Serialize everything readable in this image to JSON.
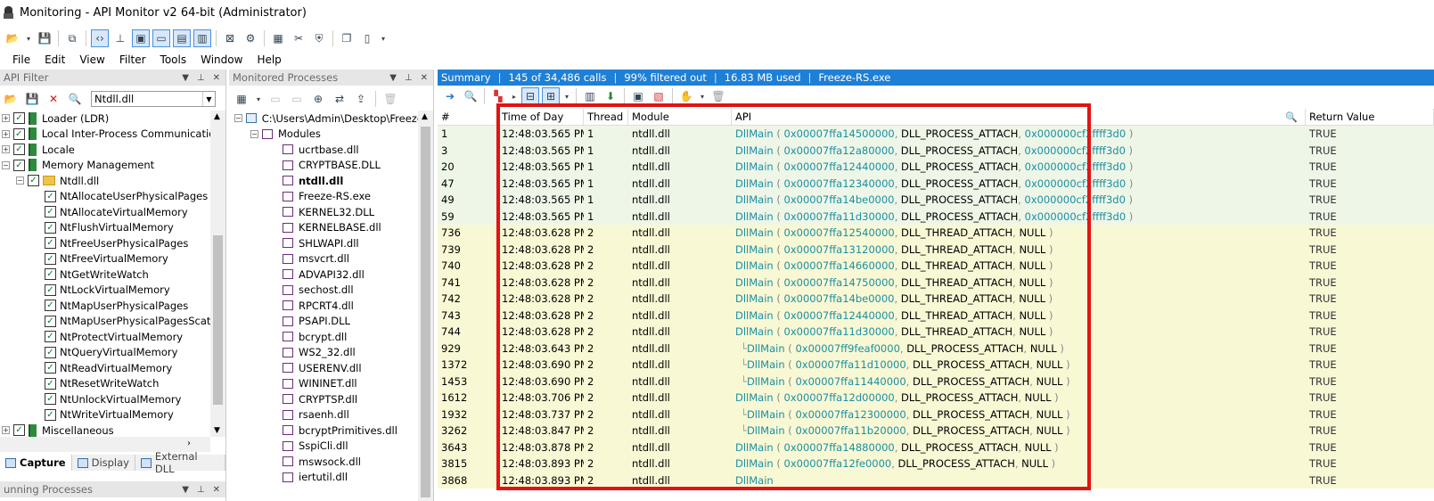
{
  "window": {
    "title": "Monitoring - API Monitor v2 64-bit (Administrator)"
  },
  "menu": [
    "File",
    "Edit",
    "View",
    "Filter",
    "Tools",
    "Window",
    "Help"
  ],
  "api_filter": {
    "title": "API Filter",
    "selected_module": "Ntdll.dll",
    "tree": [
      {
        "label": "Loader (LDR)",
        "level": 0,
        "checked": true,
        "icon": "book-icon"
      },
      {
        "label": "Local Inter-Process Communication (L",
        "level": 0,
        "checked": true,
        "icon": "book-icon"
      },
      {
        "label": "Locale",
        "level": 0,
        "checked": true,
        "icon": "book-icon"
      },
      {
        "label": "Memory Management",
        "level": 0,
        "checked": true,
        "icon": "book-icon"
      },
      {
        "label": "Ntdll.dll",
        "level": 1,
        "checked": true,
        "icon": "folder-icon"
      },
      {
        "label": "NtAllocateUserPhysicalPages",
        "level": 2,
        "checked": true
      },
      {
        "label": "NtAllocateVirtualMemory",
        "level": 2,
        "checked": true
      },
      {
        "label": "NtFlushVirtualMemory",
        "level": 2,
        "checked": true
      },
      {
        "label": "NtFreeUserPhysicalPages",
        "level": 2,
        "checked": true
      },
      {
        "label": "NtFreeVirtualMemory",
        "level": 2,
        "checked": true
      },
      {
        "label": "NtGetWriteWatch",
        "level": 2,
        "checked": true
      },
      {
        "label": "NtLockVirtualMemory",
        "level": 2,
        "checked": true
      },
      {
        "label": "NtMapUserPhysicalPages",
        "level": 2,
        "checked": true
      },
      {
        "label": "NtMapUserPhysicalPagesScat",
        "level": 2,
        "checked": true
      },
      {
        "label": "NtProtectVirtualMemory",
        "level": 2,
        "checked": true
      },
      {
        "label": "NtQueryVirtualMemory",
        "level": 2,
        "checked": true
      },
      {
        "label": "NtReadVirtualMemory",
        "level": 2,
        "checked": true
      },
      {
        "label": "NtResetWriteWatch",
        "level": 2,
        "checked": true
      },
      {
        "label": "NtUnlockVirtualMemory",
        "level": 2,
        "checked": true
      },
      {
        "label": "NtWriteVirtualMemory",
        "level": 2,
        "checked": true
      },
      {
        "label": "Miscellaneous",
        "level": 0,
        "checked": true,
        "icon": "book-icon"
      }
    ],
    "tabs": [
      "Capture",
      "Display",
      "External DLL"
    ],
    "bottom_panel_title": "unning Processes"
  },
  "monitored_processes": {
    "title": "Monitored Processes",
    "root_path": "C:\\Users\\Admin\\Desktop\\Freeze-R",
    "modules_label": "Modules",
    "modules": [
      "ucrtbase.dll",
      "CRYPTBASE.DLL",
      "ntdll.dll",
      "Freeze-RS.exe",
      "KERNEL32.DLL",
      "KERNELBASE.dll",
      "SHLWAPI.dll",
      "msvcrt.dll",
      "ADVAPI32.dll",
      "sechost.dll",
      "RPCRT4.dll",
      "PSAPI.DLL",
      "bcrypt.dll",
      "WS2_32.dll",
      "USERENV.dll",
      "WININET.dll",
      "CRYPTSP.dll",
      "rsaenh.dll",
      "bcryptPrimitives.dll",
      "SspiCli.dll",
      "mswsock.dll",
      "iertutil.dll"
    ],
    "bold_module": "ntdll.dll"
  },
  "summary": {
    "label": "Summary",
    "calls": "145 of 34,486 calls",
    "filtered": "99% filtered out",
    "memory": "16.83 MB used",
    "process": "Freeze-RS.exe"
  },
  "grid": {
    "columns": [
      "#",
      "Time of Day",
      "Thread",
      "Module",
      "API",
      "Return Value"
    ],
    "rows": [
      {
        "n": "1",
        "time": "12:48:03.565 PM",
        "thread": "1",
        "module": "ntdll.dll",
        "fn": "DllMain",
        "a1": "0x00007ffa14500000",
        "a2": "DLL_PROCESS_ATTACH",
        "a3": "0x000000cf2ffff3d0",
        "ret": "TRUE",
        "tone": "t1",
        "child": false
      },
      {
        "n": "3",
        "time": "12:48:03.565 PM",
        "thread": "1",
        "module": "ntdll.dll",
        "fn": "DllMain",
        "a1": "0x00007ffa12a80000",
        "a2": "DLL_PROCESS_ATTACH",
        "a3": "0x000000cf2ffff3d0",
        "ret": "TRUE",
        "tone": "t1",
        "child": false
      },
      {
        "n": "20",
        "time": "12:48:03.565 PM",
        "thread": "1",
        "module": "ntdll.dll",
        "fn": "DllMain",
        "a1": "0x00007ffa12440000",
        "a2": "DLL_PROCESS_ATTACH",
        "a3": "0x000000cf2ffff3d0",
        "ret": "TRUE",
        "tone": "t1",
        "child": false
      },
      {
        "n": "47",
        "time": "12:48:03.565 PM",
        "thread": "1",
        "module": "ntdll.dll",
        "fn": "DllMain",
        "a1": "0x00007ffa12340000",
        "a2": "DLL_PROCESS_ATTACH",
        "a3": "0x000000cf2ffff3d0",
        "ret": "TRUE",
        "tone": "t1",
        "child": false
      },
      {
        "n": "49",
        "time": "12:48:03.565 PM",
        "thread": "1",
        "module": "ntdll.dll",
        "fn": "DllMain",
        "a1": "0x00007ffa14be0000",
        "a2": "DLL_PROCESS_ATTACH",
        "a3": "0x000000cf2ffff3d0",
        "ret": "TRUE",
        "tone": "t1",
        "child": false
      },
      {
        "n": "59",
        "time": "12:48:03.565 PM",
        "thread": "1",
        "module": "ntdll.dll",
        "fn": "DllMain",
        "a1": "0x00007ffa11d30000",
        "a2": "DLL_PROCESS_ATTACH",
        "a3": "0x000000cf2ffff3d0",
        "ret": "TRUE",
        "tone": "t1",
        "child": false
      },
      {
        "n": "736",
        "time": "12:48:03.628 PM",
        "thread": "2",
        "module": "ntdll.dll",
        "fn": "DllMain",
        "a1": "0x00007ffa12540000",
        "a2": "DLL_THREAD_ATTACH",
        "a3": "NULL",
        "ret": "TRUE",
        "tone": "t2",
        "child": false
      },
      {
        "n": "739",
        "time": "12:48:03.628 PM",
        "thread": "2",
        "module": "ntdll.dll",
        "fn": "DllMain",
        "a1": "0x00007ffa13120000",
        "a2": "DLL_THREAD_ATTACH",
        "a3": "NULL",
        "ret": "TRUE",
        "tone": "t2",
        "child": false
      },
      {
        "n": "740",
        "time": "12:48:03.628 PM",
        "thread": "2",
        "module": "ntdll.dll",
        "fn": "DllMain",
        "a1": "0x00007ffa14660000",
        "a2": "DLL_THREAD_ATTACH",
        "a3": "NULL",
        "ret": "TRUE",
        "tone": "t2",
        "child": false
      },
      {
        "n": "741",
        "time": "12:48:03.628 PM",
        "thread": "2",
        "module": "ntdll.dll",
        "fn": "DllMain",
        "a1": "0x00007ffa14750000",
        "a2": "DLL_THREAD_ATTACH",
        "a3": "NULL",
        "ret": "TRUE",
        "tone": "t2",
        "child": false
      },
      {
        "n": "742",
        "time": "12:48:03.628 PM",
        "thread": "2",
        "module": "ntdll.dll",
        "fn": "DllMain",
        "a1": "0x00007ffa14be0000",
        "a2": "DLL_THREAD_ATTACH",
        "a3": "NULL",
        "ret": "TRUE",
        "tone": "t2",
        "child": false
      },
      {
        "n": "743",
        "time": "12:48:03.628 PM",
        "thread": "2",
        "module": "ntdll.dll",
        "fn": "DllMain",
        "a1": "0x00007ffa12440000",
        "a2": "DLL_THREAD_ATTACH",
        "a3": "NULL",
        "ret": "TRUE",
        "tone": "t2",
        "child": false
      },
      {
        "n": "744",
        "time": "12:48:03.628 PM",
        "thread": "2",
        "module": "ntdll.dll",
        "fn": "DllMain",
        "a1": "0x00007ffa11d30000",
        "a2": "DLL_THREAD_ATTACH",
        "a3": "NULL",
        "ret": "TRUE",
        "tone": "t2",
        "child": false
      },
      {
        "n": "929",
        "time": "12:48:03.643 PM",
        "thread": "2",
        "module": "ntdll.dll",
        "fn": "DllMain",
        "a1": "0x00007ff9feaf0000",
        "a2": "DLL_PROCESS_ATTACH",
        "a3": "NULL",
        "ret": "TRUE",
        "tone": "t2",
        "child": true
      },
      {
        "n": "1372",
        "time": "12:48:03.690 PM",
        "thread": "2",
        "module": "ntdll.dll",
        "fn": "DllMain",
        "a1": "0x00007ffa11d10000",
        "a2": "DLL_PROCESS_ATTACH",
        "a3": "NULL",
        "ret": "TRUE",
        "tone": "t2",
        "child": true
      },
      {
        "n": "1453",
        "time": "12:48:03.690 PM",
        "thread": "2",
        "module": "ntdll.dll",
        "fn": "DllMain",
        "a1": "0x00007ffa11440000",
        "a2": "DLL_PROCESS_ATTACH",
        "a3": "NULL",
        "ret": "TRUE",
        "tone": "t2",
        "child": true
      },
      {
        "n": "1612",
        "time": "12:48:03.706 PM",
        "thread": "2",
        "module": "ntdll.dll",
        "fn": "DllMain",
        "a1": "0x00007ffa12d00000",
        "a2": "DLL_PROCESS_ATTACH",
        "a3": "NULL",
        "ret": "TRUE",
        "tone": "t2",
        "child": false
      },
      {
        "n": "1932",
        "time": "12:48:03.737 PM",
        "thread": "2",
        "module": "ntdll.dll",
        "fn": "DllMain",
        "a1": "0x00007ffa12300000",
        "a2": "DLL_PROCESS_ATTACH",
        "a3": "NULL",
        "ret": "TRUE",
        "tone": "t2",
        "child": true
      },
      {
        "n": "3262",
        "time": "12:48:03.847 PM",
        "thread": "2",
        "module": "ntdll.dll",
        "fn": "DllMain",
        "a1": "0x00007ffa11b20000",
        "a2": "DLL_PROCESS_ATTACH",
        "a3": "NULL",
        "ret": "TRUE",
        "tone": "t2",
        "child": true
      },
      {
        "n": "3643",
        "time": "12:48:03.878 PM",
        "thread": "2",
        "module": "ntdll.dll",
        "fn": "DllMain",
        "a1": "0x00007ffa14880000",
        "a2": "DLL_PROCESS_ATTACH",
        "a3": "NULL",
        "ret": "TRUE",
        "tone": "t2",
        "child": false
      },
      {
        "n": "3815",
        "time": "12:48:03.893 PM",
        "thread": "2",
        "module": "ntdll.dll",
        "fn": "DllMain",
        "a1": "0x00007ffa12fe0000",
        "a2": "DLL_PROCESS_ATTACH",
        "a3": "NULL",
        "ret": "TRUE",
        "tone": "t2",
        "child": false
      },
      {
        "n": "3868",
        "time": "12:48:03.893 PM",
        "thread": "2",
        "module": "ntdll.dll",
        "fn": "DllMain",
        "a1": "",
        "a2": "",
        "a3": "",
        "ret": "TRUE",
        "tone": "t2",
        "child": false
      }
    ]
  },
  "colors": {
    "summary_bar": "#1e7fd6",
    "highlight_box": "#e31313",
    "row_thread1": "#eef6e8",
    "row_thread2": "#f9f8d5",
    "api_name": "#1a8fa0"
  }
}
